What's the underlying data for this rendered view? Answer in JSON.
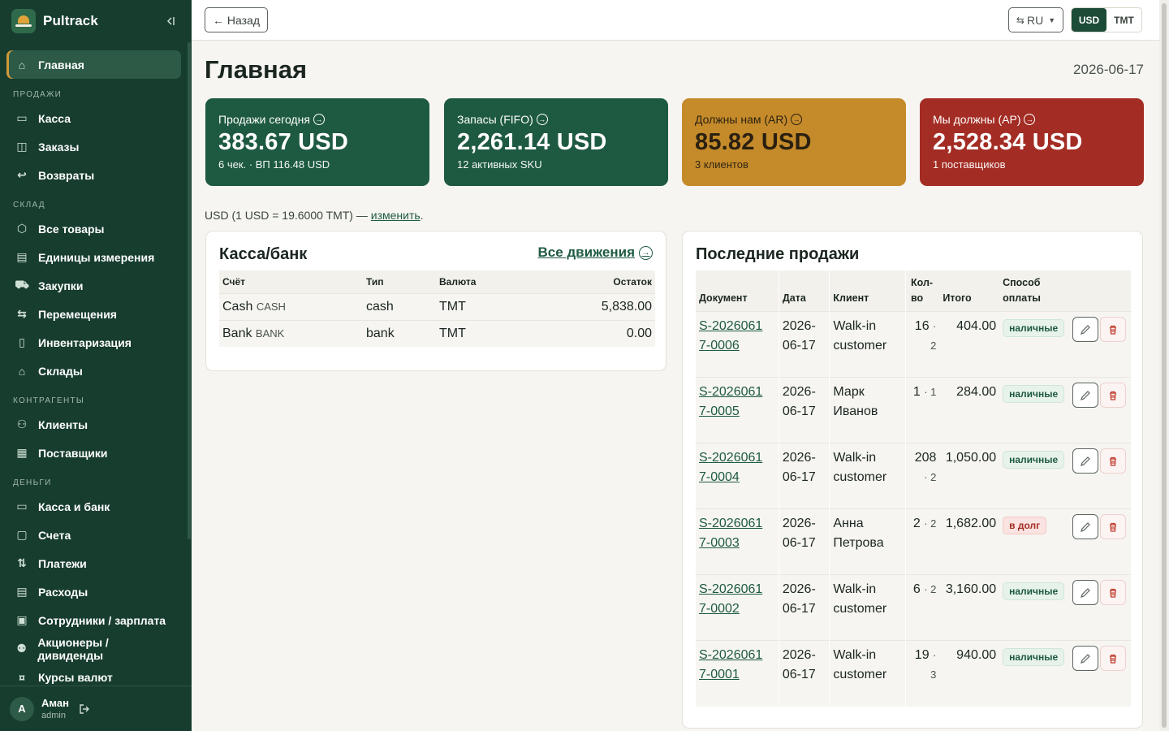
{
  "brand": {
    "name": "Pultrack"
  },
  "sidebar": {
    "groups": [
      {
        "section": "",
        "items": [
          {
            "label": "Главная",
            "icon": "home-icon",
            "active": true
          }
        ]
      },
      {
        "section": "Продажи",
        "items": [
          {
            "label": "Касса",
            "icon": "register-icon"
          },
          {
            "label": "Заказы",
            "icon": "bag-icon"
          },
          {
            "label": "Возвраты",
            "icon": "return-icon"
          }
        ]
      },
      {
        "section": "Склад",
        "items": [
          {
            "label": "Все товары",
            "icon": "box-icon"
          },
          {
            "label": "Единицы измерения",
            "icon": "ruler-icon"
          },
          {
            "label": "Закупки",
            "icon": "truck-icon"
          },
          {
            "label": "Перемещения",
            "icon": "transfer-icon"
          },
          {
            "label": "Инвентаризация",
            "icon": "clipboard-icon"
          },
          {
            "label": "Склады",
            "icon": "warehouse-icon"
          }
        ]
      },
      {
        "section": "Контрагенты",
        "items": [
          {
            "label": "Клиенты",
            "icon": "users-icon"
          },
          {
            "label": "Поставщики",
            "icon": "building-icon"
          }
        ]
      },
      {
        "section": "Деньги",
        "items": [
          {
            "label": "Касса и банк",
            "icon": "wallet-icon"
          },
          {
            "label": "Счета",
            "icon": "folder-icon"
          },
          {
            "label": "Платежи",
            "icon": "arrows-icon"
          },
          {
            "label": "Расходы",
            "icon": "receipt-icon"
          },
          {
            "label": "Сотрудники / зарплата",
            "icon": "badge-icon"
          },
          {
            "label": "Акционеры / дивиденды",
            "icon": "group-icon"
          },
          {
            "label": "Курсы валют",
            "icon": "currency-icon"
          }
        ]
      }
    ],
    "user": {
      "initial": "A",
      "name": "Аман",
      "role": "admin"
    }
  },
  "topbar": {
    "back_label": "← Назад",
    "lang": "RU",
    "currencies": [
      {
        "label": "USD",
        "active": true
      },
      {
        "label": "TMT",
        "active": false
      }
    ]
  },
  "page": {
    "title": "Главная",
    "date": "2026-06-17"
  },
  "cards": [
    {
      "title": "Продажи сегодня",
      "value": "383.67 USD",
      "sub": "6 чек. · ВП 116.48 USD",
      "color": "#1e5a41"
    },
    {
      "title": "Запасы (FIFO)",
      "value": "2,261.14 USD",
      "sub": "12 активных SKU",
      "color": "#1e5a41"
    },
    {
      "title": "Должны нам (AR)",
      "value": "85.82 USD",
      "sub": "3 клиентов",
      "color": "#c58b2a"
    },
    {
      "title": "Мы должны (AP)",
      "value": "2,528.34 USD",
      "sub": "1 поставщиков",
      "color": "#a32d24"
    }
  ],
  "rate": {
    "text": "USD (1 USD = 19.6000 TMT) — ",
    "link": "изменить",
    "tail": "."
  },
  "bank": {
    "title": "Касса/банк",
    "link": "Все движения",
    "columns": [
      "Счёт",
      "Тип",
      "Валюта",
      "Остаток"
    ],
    "rows": [
      {
        "name": "Cash",
        "code": "CASH",
        "type": "cash",
        "currency": "TMT",
        "balance": "5,838.00"
      },
      {
        "name": "Bank",
        "code": "BANK",
        "type": "bank",
        "currency": "TMT",
        "balance": "0.00"
      }
    ]
  },
  "sales": {
    "title": "Последние продажи",
    "columns": {
      "doc": "Документ",
      "date": "Дата",
      "client": "Клиент",
      "qty": "Кол-во",
      "total": "Итого",
      "pay": "Способ оплаты"
    },
    "rows": [
      {
        "doc": "S-20260617-0006",
        "date": "2026-06-17",
        "client": "Walk-in customer",
        "qty": "16",
        "lines": "2",
        "total": "404.00",
        "pay": "наличные",
        "debt": false
      },
      {
        "doc": "S-20260617-0005",
        "date": "2026-06-17",
        "client": "Марк Иванов",
        "qty": "1",
        "lines": "1",
        "total": "284.00",
        "pay": "наличные",
        "debt": false
      },
      {
        "doc": "S-20260617-0004",
        "date": "2026-06-17",
        "client": "Walk-in customer",
        "qty": "208",
        "lines": "2",
        "total": "1,050.00",
        "pay": "наличные",
        "debt": false
      },
      {
        "doc": "S-20260617-0003",
        "date": "2026-06-17",
        "client": "Анна Петрова",
        "qty": "2",
        "lines": "2",
        "total": "1,682.00",
        "pay": "в долг",
        "debt": true
      },
      {
        "doc": "S-20260617-0002",
        "date": "2026-06-17",
        "client": "Walk-in customer",
        "qty": "6",
        "lines": "2",
        "total": "3,160.00",
        "pay": "наличные",
        "debt": false
      },
      {
        "doc": "S-20260617-0001",
        "date": "2026-06-17",
        "client": "Walk-in customer",
        "qty": "19",
        "lines": "3",
        "total": "940.00",
        "pay": "наличные",
        "debt": false
      }
    ]
  }
}
